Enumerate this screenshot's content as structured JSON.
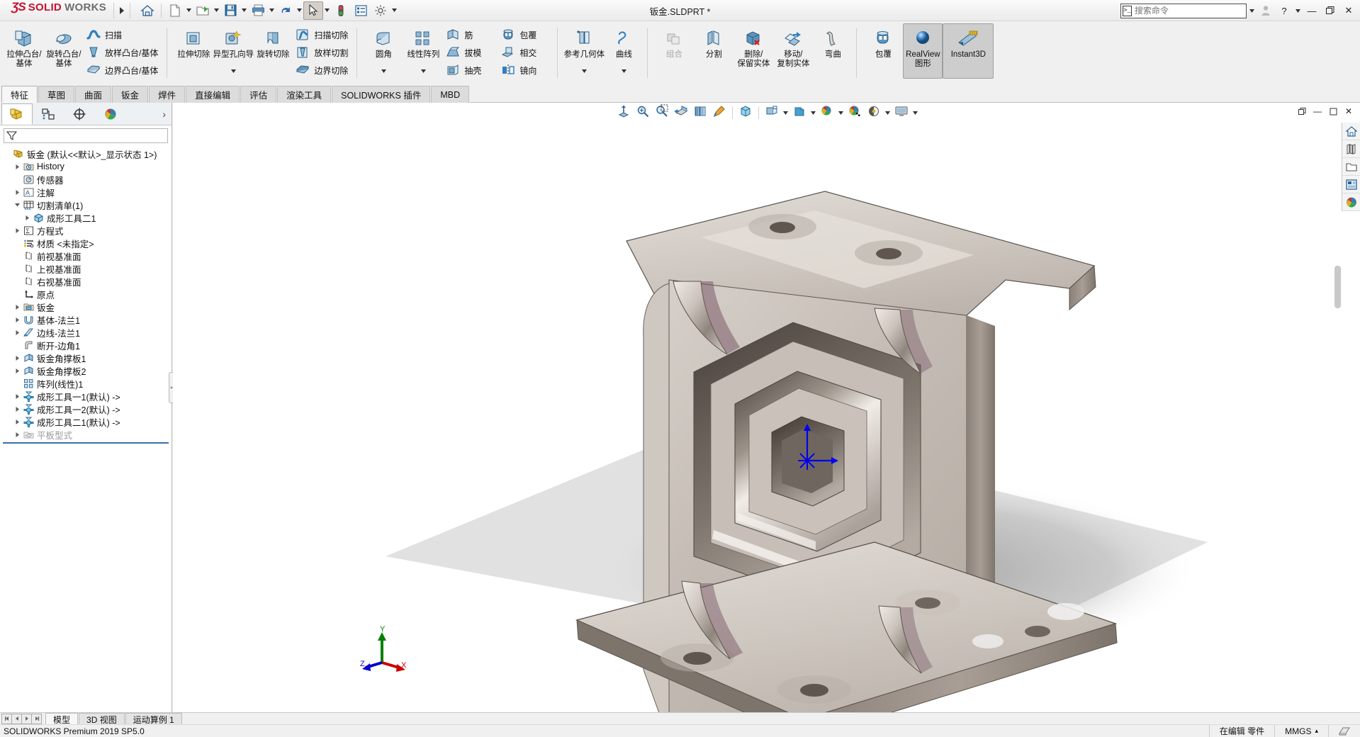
{
  "app": {
    "brand_ds": "ƷS",
    "brand_solid": "SOLID",
    "brand_works": "WORKS",
    "document_title": "钣金.SLDPRT *",
    "version_status": "SOLIDWORKS Premium 2019 SP5.0"
  },
  "quick_access": {
    "items": [
      {
        "name": "home-icon",
        "label": "主页",
        "dropdown": false
      },
      {
        "name": "new-document-icon",
        "label": "新建",
        "dropdown": true
      },
      {
        "name": "open-folder-icon",
        "label": "打开",
        "dropdown": true
      },
      {
        "name": "save-icon",
        "label": "保存",
        "dropdown": true
      },
      {
        "name": "print-icon",
        "label": "打印",
        "dropdown": true
      },
      {
        "name": "undo-icon",
        "label": "撤销",
        "dropdown": true
      },
      {
        "name": "select-cursor-icon",
        "label": "选择",
        "dropdown": true,
        "active": true
      },
      {
        "name": "rebuild-traffic-light-icon",
        "label": "重建模型",
        "dropdown": false
      },
      {
        "name": "options-list-icon",
        "label": "文件属性",
        "dropdown": false
      },
      {
        "name": "gear-settings-icon",
        "label": "选项",
        "dropdown": true
      }
    ]
  },
  "search": {
    "placeholder": "搜索命令",
    "value": ""
  },
  "window_controls": {
    "account": "账户",
    "help": "?",
    "help_caret": "▾",
    "minimize": "—",
    "restore": "❐",
    "close": "✕"
  },
  "ribbon": {
    "groups": [
      {
        "name": "boss-base-group",
        "big": [
          {
            "name": "extruded-boss-base-button",
            "label": "拉伸凸台/基体",
            "icon": "extrude-boss-icon",
            "caret": false
          },
          {
            "name": "revolved-boss-base-button",
            "label": "旋转凸台/基体",
            "icon": "revolve-boss-icon",
            "caret": false
          }
        ],
        "small": [
          {
            "name": "swept-boss-button",
            "label": "扫描",
            "icon": "sweep-icon"
          },
          {
            "name": "lofted-boss-button",
            "label": "放样凸台/基体",
            "icon": "loft-icon"
          },
          {
            "name": "boundary-boss-button",
            "label": "边界凸台/基体",
            "icon": "boundary-icon"
          }
        ]
      },
      {
        "name": "cut-group",
        "big": [
          {
            "name": "extruded-cut-button",
            "label": "拉伸切除",
            "icon": "extrude-cut-icon",
            "caret": false
          },
          {
            "name": "hole-wizard-button",
            "label": "异型孔向导",
            "icon": "hole-wizard-icon",
            "caret": true
          },
          {
            "name": "revolved-cut-button",
            "label": "旋转切除",
            "icon": "revolve-cut-icon",
            "caret": false
          }
        ],
        "small": [
          {
            "name": "swept-cut-button",
            "label": "扫描切除",
            "icon": "sweep-cut-icon"
          },
          {
            "name": "lofted-cut-button",
            "label": "放样切割",
            "icon": "loft-cut-icon"
          },
          {
            "name": "boundary-cut-button",
            "label": "边界切除",
            "icon": "boundary-cut-icon"
          }
        ]
      },
      {
        "name": "fillet-pattern-group",
        "big": [
          {
            "name": "fillet-button",
            "label": "圆角",
            "icon": "fillet-icon",
            "caret": true
          },
          {
            "name": "linear-pattern-button",
            "label": "线性阵列",
            "icon": "linear-pattern-icon",
            "caret": true
          }
        ],
        "small": [
          {
            "name": "rib-button",
            "label": "筋",
            "icon": "rib-icon"
          },
          {
            "name": "draft-button",
            "label": "拔模",
            "icon": "draft-icon"
          },
          {
            "name": "shell-button",
            "label": "抽壳",
            "icon": "shell-icon"
          }
        ],
        "small2": [
          {
            "name": "wrap-button",
            "label": "包覆",
            "icon": "wrap-icon"
          },
          {
            "name": "intersect-button",
            "label": "相交",
            "icon": "intersect-icon"
          },
          {
            "name": "mirror-button",
            "label": "镜向",
            "icon": "mirror-icon"
          }
        ]
      },
      {
        "name": "reference-curve-group",
        "big": [
          {
            "name": "reference-geometry-button",
            "label": "参考几何体",
            "icon": "reference-geometry-icon",
            "caret": true
          },
          {
            "name": "curves-button",
            "label": "曲线",
            "icon": "curve-icon",
            "caret": true
          }
        ]
      },
      {
        "name": "body-ops-group",
        "big": [
          {
            "name": "combine-button",
            "label": "组合",
            "icon": "combine-icon",
            "caret": false,
            "disabled": true
          },
          {
            "name": "split-button",
            "label": "分割",
            "icon": "split-icon",
            "caret": false
          },
          {
            "name": "delete-keep-body-button",
            "label": "删除/保留实体",
            "icon": "delete-body-icon",
            "caret": false
          },
          {
            "name": "move-copy-body-button",
            "label": "移动/复制实体",
            "icon": "move-copy-icon",
            "caret": false
          },
          {
            "name": "flex-button",
            "label": "弯曲",
            "icon": "flex-icon",
            "caret": false
          }
        ]
      },
      {
        "name": "display-group",
        "big": [
          {
            "name": "wrap2-button",
            "label": "包覆",
            "icon": "wrap-icon",
            "caret": false
          },
          {
            "name": "realview-graphics-button",
            "label": "RealView 图形",
            "icon": "realview-icon",
            "caret": false,
            "selected": true
          },
          {
            "name": "instant3d-button",
            "label": "Instant3D",
            "icon": "instant3d-icon",
            "caret": false,
            "selected": true
          }
        ]
      }
    ]
  },
  "tabs": {
    "items": [
      {
        "name": "tab-features",
        "label": "特征",
        "active": true
      },
      {
        "name": "tab-sketch",
        "label": "草图",
        "active": false
      },
      {
        "name": "tab-surface",
        "label": "曲面",
        "active": false
      },
      {
        "name": "tab-sheetmetal",
        "label": "钣金",
        "active": false
      },
      {
        "name": "tab-weldment",
        "label": "焊件",
        "active": false
      },
      {
        "name": "tab-direct-edit",
        "label": "直接编辑",
        "active": false
      },
      {
        "name": "tab-evaluate",
        "label": "评估",
        "active": false
      },
      {
        "name": "tab-render-tools",
        "label": "渲染工具",
        "active": false
      },
      {
        "name": "tab-solidworks-addins",
        "label": "SOLIDWORKS 插件",
        "active": false
      },
      {
        "name": "tab-mbd",
        "label": "MBD",
        "active": false
      }
    ]
  },
  "feature_manager": {
    "tabs": [
      {
        "name": "feature-manager-tab",
        "icon": "feature-tree-icon",
        "active": true
      },
      {
        "name": "property-manager-tab",
        "icon": "property-manager-icon",
        "active": false
      },
      {
        "name": "configuration-manager-tab",
        "icon": "configuration-icon",
        "active": false
      },
      {
        "name": "display-manager-tab",
        "icon": "display-manager-icon",
        "active": false
      }
    ],
    "expand_arrow": "›",
    "filter_placeholder": "",
    "tree": [
      {
        "name": "tree-root-part",
        "label": "钣金  (默认<<默认>_显示状态 1>)",
        "indent": 0,
        "toggle": "none",
        "icon": "part-icon",
        "dim": false
      },
      {
        "name": "tree-item-history",
        "label": "History",
        "indent": 1,
        "toggle": "collapsed",
        "icon": "history-folder-icon",
        "dim": false
      },
      {
        "name": "tree-item-sensors",
        "label": "传感器",
        "indent": 1,
        "toggle": "none",
        "icon": "sensor-icon",
        "dim": false
      },
      {
        "name": "tree-item-annotations",
        "label": "注解",
        "indent": 1,
        "toggle": "collapsed",
        "icon": "annotation-icon",
        "dim": false
      },
      {
        "name": "tree-item-cutlist",
        "label": "切割清单(1)",
        "indent": 1,
        "toggle": "expanded",
        "icon": "cutlist-icon",
        "dim": false
      },
      {
        "name": "tree-item-forming-tool-2-1",
        "label": "成形工具二1",
        "indent": 2,
        "toggle": "collapsed",
        "icon": "solid-body-icon",
        "dim": false
      },
      {
        "name": "tree-item-equations",
        "label": "方程式",
        "indent": 1,
        "toggle": "collapsed",
        "icon": "equation-icon",
        "dim": false
      },
      {
        "name": "tree-item-material",
        "label": "材质 <未指定>",
        "indent": 1,
        "toggle": "none",
        "icon": "material-icon",
        "dim": false
      },
      {
        "name": "tree-item-front-plane",
        "label": "前视基准面",
        "indent": 1,
        "toggle": "none",
        "icon": "plane-icon",
        "dim": false
      },
      {
        "name": "tree-item-top-plane",
        "label": "上视基准面",
        "indent": 1,
        "toggle": "none",
        "icon": "plane-icon",
        "dim": false
      },
      {
        "name": "tree-item-right-plane",
        "label": "右视基准面",
        "indent": 1,
        "toggle": "none",
        "icon": "plane-icon",
        "dim": false
      },
      {
        "name": "tree-item-origin",
        "label": "原点",
        "indent": 1,
        "toggle": "none",
        "icon": "origin-icon",
        "dim": false
      },
      {
        "name": "tree-item-sheetmetal",
        "label": "钣金",
        "indent": 1,
        "toggle": "collapsed",
        "icon": "sheetmetal-folder-icon",
        "dim": false
      },
      {
        "name": "tree-item-base-flange-1",
        "label": "基体-法兰1",
        "indent": 1,
        "toggle": "collapsed",
        "icon": "base-flange-icon",
        "dim": false
      },
      {
        "name": "tree-item-edge-flange-1",
        "label": "边线-法兰1",
        "indent": 1,
        "toggle": "collapsed",
        "icon": "edge-flange-icon",
        "dim": false
      },
      {
        "name": "tree-item-break-corner-1",
        "label": "断开-边角1",
        "indent": 1,
        "toggle": "none",
        "icon": "break-corner-icon",
        "dim": false
      },
      {
        "name": "tree-item-gusset-1",
        "label": "钣金角撑板1",
        "indent": 1,
        "toggle": "collapsed",
        "icon": "gusset-icon",
        "dim": false
      },
      {
        "name": "tree-item-gusset-2",
        "label": "钣金角撑板2",
        "indent": 1,
        "toggle": "collapsed",
        "icon": "gusset-icon",
        "dim": false
      },
      {
        "name": "tree-item-pattern-linear-1",
        "label": "阵列(线性)1",
        "indent": 1,
        "toggle": "none",
        "icon": "linear-pattern-icon",
        "dim": false
      },
      {
        "name": "tree-item-forming-tool-1-1",
        "label": "成形工具一1(默认) ->",
        "indent": 1,
        "toggle": "collapsed",
        "icon": "forming-tool-icon",
        "dim": false
      },
      {
        "name": "tree-item-forming-tool-1-2",
        "label": "成形工具一2(默认) ->",
        "indent": 1,
        "toggle": "collapsed",
        "icon": "forming-tool-icon",
        "dim": false
      },
      {
        "name": "tree-item-forming-tool-2-1b",
        "label": "成形工具二1(默认) ->",
        "indent": 1,
        "toggle": "collapsed",
        "icon": "forming-tool-icon",
        "dim": false
      },
      {
        "name": "tree-item-flat-pattern",
        "label": "平板型式",
        "indent": 1,
        "toggle": "collapsed",
        "icon": "flat-pattern-icon",
        "dim": true
      }
    ]
  },
  "view_toolbar": {
    "items": [
      {
        "name": "zoom-to-fit-button",
        "icon": "zoom-fit-icon",
        "dropdown": false
      },
      {
        "name": "zoom-to-area-button",
        "icon": "zoom-area-icon",
        "dropdown": false
      },
      {
        "name": "previous-view-button",
        "icon": "zoom-previous-icon",
        "dropdown": false
      },
      {
        "name": "section-view-button",
        "icon": "section-view-icon",
        "dropdown": false
      },
      {
        "name": "view-orientation-button",
        "icon": "view-orientation-icon",
        "dropdown": false
      },
      {
        "name": "appearance-button",
        "icon": "appearance-brush-icon",
        "dropdown": false
      },
      {
        "name": "view-cube-button",
        "icon": "view-cube-icon",
        "dropdown": false
      },
      {
        "name": "display-style-button",
        "icon": "display-style-icon",
        "dropdown": true
      },
      {
        "name": "hide-show-items-button",
        "icon": "hide-show-icon",
        "dropdown": true
      },
      {
        "name": "edit-appearance-button",
        "icon": "edit-appearance-icon",
        "dropdown": true
      },
      {
        "name": "apply-scene-button",
        "icon": "apply-scene-icon",
        "dropdown": false
      },
      {
        "name": "view-settings-button",
        "icon": "view-settings-icon",
        "dropdown": true
      },
      {
        "name": "viewport-button",
        "icon": "viewport-icon",
        "dropdown": true
      }
    ]
  },
  "graphics_window_controls": {
    "restore": "❐",
    "minimize": "—",
    "maximize": "❐",
    "close": "✕"
  },
  "task_pane": {
    "items": [
      {
        "name": "task-pane-resources-icon",
        "label": "SOLIDWORKS 资源"
      },
      {
        "name": "task-pane-design-library-icon",
        "label": "设计库"
      },
      {
        "name": "task-pane-file-explorer-icon",
        "label": "文件探索器"
      },
      {
        "name": "task-pane-view-palette-icon",
        "label": "视图调色板"
      },
      {
        "name": "task-pane-appearances-icon",
        "label": "外观、场景和贴图"
      }
    ]
  },
  "triad": {
    "x_label": "X",
    "y_label": "Y",
    "z_label": "Z",
    "x_color": "#cc0000",
    "y_color": "#008000",
    "z_color": "#0000cc"
  },
  "bottom_tabs": {
    "nav": [
      "⏮",
      "◀",
      "▶",
      "⏭"
    ],
    "items": [
      {
        "name": "bottom-tab-model",
        "label": "模型",
        "active": true
      },
      {
        "name": "bottom-tab-3dviews",
        "label": "3D 视图",
        "active": false
      },
      {
        "name": "bottom-tab-motion-study",
        "label": "运动算例 1",
        "active": false
      }
    ]
  },
  "status_bar": {
    "left": "SOLIDWORKS Premium 2019 SP5.0",
    "edit_state": "在编辑 零件",
    "units": "MMGS",
    "units_caret": "▴",
    "overlay_icon": "sheet-icon"
  },
  "colors": {
    "accent_red": "#c8102e",
    "ribbon_bg": "#f0f0f0",
    "selected_tab": "#f6f6f6",
    "tree_highlight": "#3a6ea5",
    "model_metal": "#c9c2bb"
  }
}
